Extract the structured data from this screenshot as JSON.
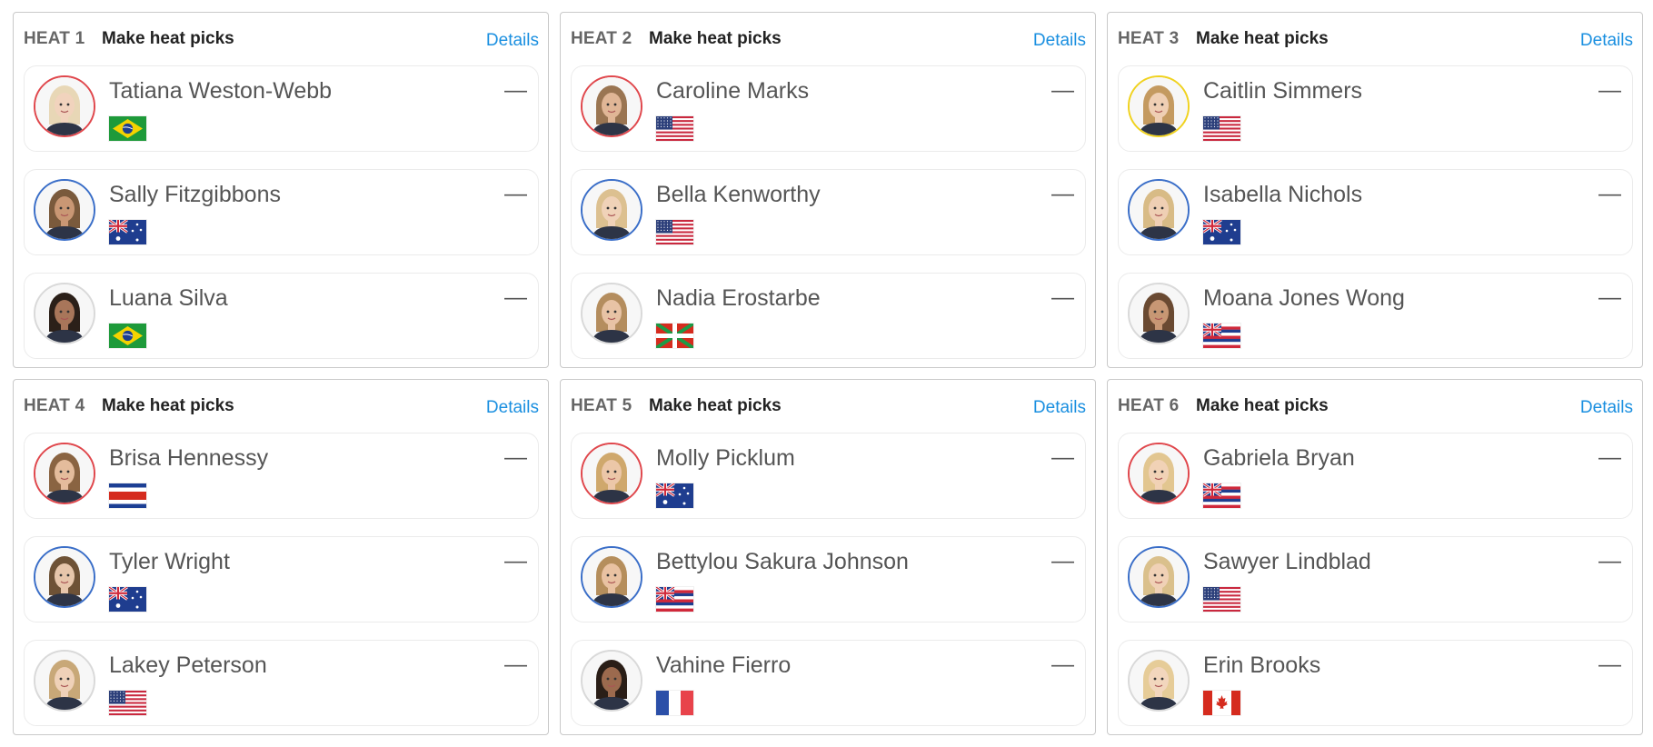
{
  "colors": {
    "details_link": "#1a8fe0",
    "ring_red": "#e0474c",
    "ring_blue": "#3a6ec8",
    "ring_yellow": "#f0d21e",
    "ring_gray": "#d9d9d9"
  },
  "heats": [
    {
      "number": "HEAT 1",
      "title": "Make heat picks",
      "details": "Details",
      "surfers": [
        {
          "name": "Tatiana Weston-Webb",
          "score": "—",
          "flag": "brazil-flag",
          "ring": "red",
          "hair": "#e8d7b6",
          "skin": "#f1d3bd"
        },
        {
          "name": "Sally Fitzgibbons",
          "score": "—",
          "flag": "australia-flag",
          "ring": "blue",
          "hair": "#7a5a3c",
          "skin": "#c99774"
        },
        {
          "name": "Luana Silva",
          "score": "—",
          "flag": "brazil-flag",
          "ring": "gray",
          "hair": "#2b2019",
          "skin": "#a8765a"
        }
      ]
    },
    {
      "number": "HEAT 2",
      "title": "Make heat picks",
      "details": "Details",
      "surfers": [
        {
          "name": "Caroline Marks",
          "score": "—",
          "flag": "usa-flag",
          "ring": "red",
          "hair": "#9a7552",
          "skin": "#e0b696"
        },
        {
          "name": "Bella Kenworthy",
          "score": "—",
          "flag": "usa-flag",
          "ring": "blue",
          "hair": "#dcc090",
          "skin": "#f0d2b8"
        },
        {
          "name": "Nadia Erostarbe",
          "score": "—",
          "flag": "basque-flag",
          "ring": "gray",
          "hair": "#b48d5e",
          "skin": "#e8c3a5"
        }
      ]
    },
    {
      "number": "HEAT 3",
      "title": "Make heat picks",
      "details": "Details",
      "surfers": [
        {
          "name": "Caitlin Simmers",
          "score": "—",
          "flag": "usa-flag",
          "ring": "yellow",
          "hair": "#c49a60",
          "skin": "#efcfb4"
        },
        {
          "name": "Isabella Nichols",
          "score": "—",
          "flag": "australia-flag",
          "ring": "blue",
          "hair": "#d8bb86",
          "skin": "#efcfb4"
        },
        {
          "name": "Moana Jones Wong",
          "score": "—",
          "flag": "hawaii-flag",
          "ring": "gray",
          "hair": "#6a4a32",
          "skin": "#c79774"
        }
      ]
    },
    {
      "number": "HEAT 4",
      "title": "Make heat picks",
      "details": "Details",
      "surfers": [
        {
          "name": "Brisa Hennessy",
          "score": "—",
          "flag": "costa-rica-flag",
          "ring": "red",
          "hair": "#8a6442",
          "skin": "#e4bc9c"
        },
        {
          "name": "Tyler Wright",
          "score": "—",
          "flag": "australia-flag",
          "ring": "blue",
          "hair": "#6e5236",
          "skin": "#e7c6ab"
        },
        {
          "name": "Lakey Peterson",
          "score": "—",
          "flag": "usa-flag",
          "ring": "gray",
          "hair": "#c8a878",
          "skin": "#efd1b8"
        }
      ]
    },
    {
      "number": "HEAT 5",
      "title": "Make heat picks",
      "details": "Details",
      "surfers": [
        {
          "name": "Molly Picklum",
          "score": "—",
          "flag": "australia-flag",
          "ring": "red",
          "hair": "#cfa86c",
          "skin": "#ecc7a8"
        },
        {
          "name": "Bettylou Sakura Johnson",
          "score": "—",
          "flag": "hawaii-flag",
          "ring": "blue",
          "hair": "#b58e5c",
          "skin": "#e9c2a2"
        },
        {
          "name": "Vahine Fierro",
          "score": "—",
          "flag": "france-flag",
          "ring": "gray",
          "hair": "#2a1e17",
          "skin": "#9c6a4e"
        }
      ]
    },
    {
      "number": "HEAT 6",
      "title": "Make heat picks",
      "details": "Details",
      "surfers": [
        {
          "name": "Gabriela Bryan",
          "score": "—",
          "flag": "hawaii-flag",
          "ring": "red",
          "hair": "#e2c690",
          "skin": "#f1d2b6"
        },
        {
          "name": "Sawyer Lindblad",
          "score": "—",
          "flag": "usa-flag",
          "ring": "blue",
          "hair": "#dac08c",
          "skin": "#f0d1b6"
        },
        {
          "name": "Erin Brooks",
          "score": "—",
          "flag": "canada-flag",
          "ring": "gray",
          "hair": "#e6cc98",
          "skin": "#f2d6bd"
        }
      ]
    }
  ]
}
